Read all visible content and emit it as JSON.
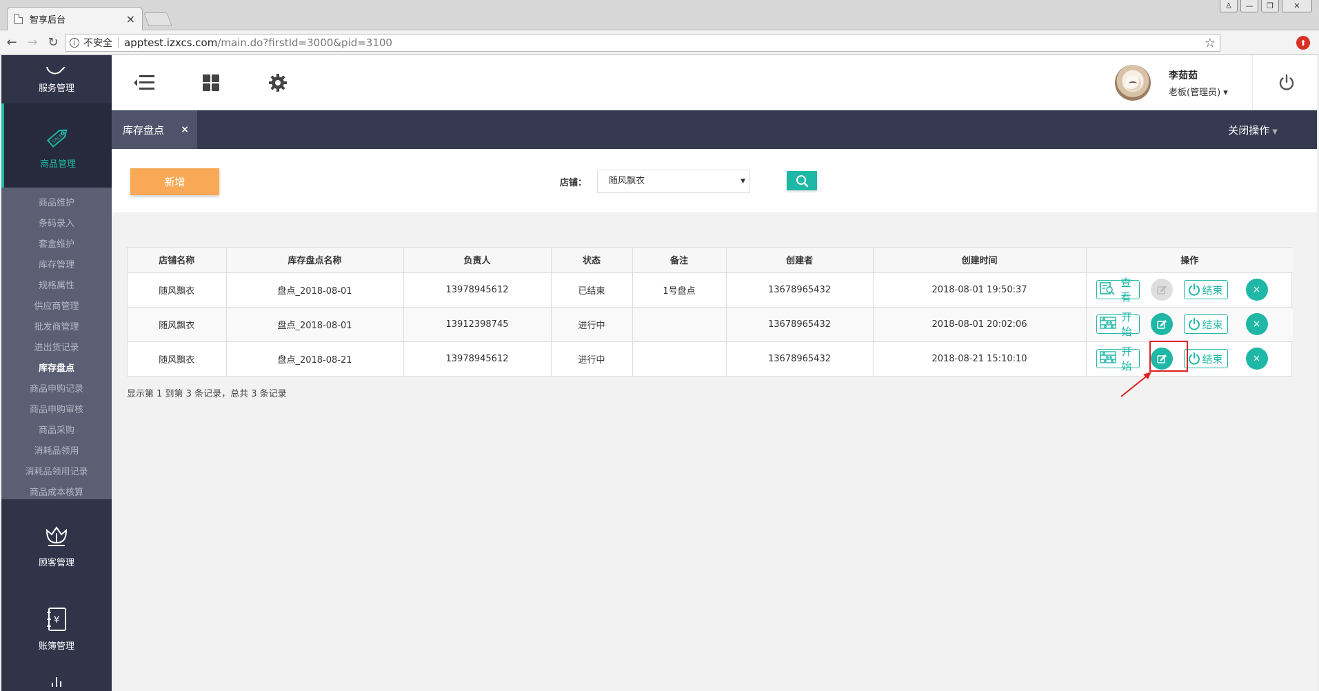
{
  "browser": {
    "tab_title": "智享后台",
    "tab_close": "×",
    "address": {
      "security_label": "不安全",
      "url_host": "apptest.izxcs.com",
      "url_path": "/main.do?firstId=3000&pid=3100"
    },
    "window_buttons": [
      "♙",
      "—",
      "❐",
      "✕"
    ]
  },
  "sidebar": {
    "modules": {
      "service": "服务管理",
      "goods": "商品管理",
      "customer": "顾客管理",
      "account": "账簿管理"
    },
    "goods_sub": [
      {
        "label": "商品维护",
        "active": false
      },
      {
        "label": "条码录入",
        "active": false
      },
      {
        "label": "套盒维护",
        "active": false
      },
      {
        "label": "库存管理",
        "active": false
      },
      {
        "label": "规格属性",
        "active": false
      },
      {
        "label": "供应商管理",
        "active": false
      },
      {
        "label": "批发商管理",
        "active": false
      },
      {
        "label": "进出货记录",
        "active": false
      },
      {
        "label": "库存盘点",
        "active": true
      },
      {
        "label": "商品申购记录",
        "active": false
      },
      {
        "label": "商品申购审核",
        "active": false
      },
      {
        "label": "商品采购",
        "active": false
      },
      {
        "label": "消耗品领用",
        "active": false
      },
      {
        "label": "消耗品领用记录",
        "active": false
      },
      {
        "label": "商品成本核算",
        "active": false
      }
    ]
  },
  "header": {
    "user_name": "李茹茹",
    "user_role": "老板(管理员) ▾"
  },
  "tabs": {
    "current": "库存盘点",
    "close": "×",
    "close_ops": "关闭操作"
  },
  "toolbar": {
    "add_label": "新增",
    "store_label": "店铺：",
    "store_value": "随风飘衣"
  },
  "table": {
    "headers": [
      "店铺名称",
      "库存盘点名称",
      "负责人",
      "状态",
      "备注",
      "创建者",
      "创建时间",
      "操作"
    ],
    "rows": [
      {
        "store": "随风飘衣",
        "name": "盘点_2018-08-01",
        "owner": "13978945612",
        "status": "已结束",
        "remark": "1号盘点",
        "creator": "13678965432",
        "created": "2018-08-01 19:50:37",
        "primary_op": "查看",
        "edit_enabled": false
      },
      {
        "store": "随风飘衣",
        "name": "盘点_2018-08-01",
        "owner": "13912398745",
        "status": "进行中",
        "remark": "",
        "creator": "13678965432",
        "created": "2018-08-01 20:02:06",
        "primary_op": "开始",
        "edit_enabled": true
      },
      {
        "store": "随风飘衣",
        "name": "盘点_2018-08-21",
        "owner": "13978945612",
        "status": "进行中",
        "remark": "",
        "creator": "13678965432",
        "created": "2018-08-21 15:10:10",
        "primary_op": "开始",
        "edit_enabled": true
      }
    ],
    "end_label": "结束",
    "delete_label": "×"
  },
  "pagination": {
    "info": "显示第 1 到第 3 条记录，总共 3 条记录"
  },
  "colors": {
    "accent": "#1fb7a6",
    "add_button": "#f9a856",
    "sidebar_bg": "#2f3449",
    "tabbar_bg": "#353a52",
    "highlight": "#e02020"
  },
  "icons": {
    "menu_toggle": "menu-collapse-icon",
    "dashboard": "grid-icon",
    "settings": "gear-icon",
    "power": "power-icon",
    "search": "search-icon",
    "view": "view-icon",
    "start": "abacus-icon",
    "edit": "edit-icon",
    "end": "power-icon",
    "delete": "close-icon"
  }
}
